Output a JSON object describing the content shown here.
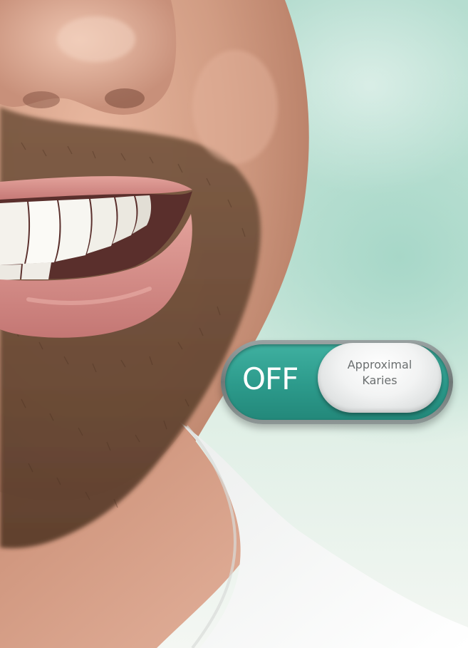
{
  "image": {
    "subject": "smiling-man-beard-closeup",
    "colors": {
      "skin": "#d9a38a",
      "beard": "#6a4a34",
      "lips": "#d28a86",
      "teeth": "#f7f6f2",
      "shirt": "#f7f7f5",
      "background": "#b6ddd0"
    }
  },
  "toggle": {
    "state_label": "OFF",
    "feature_label_line1": "Approximal",
    "feature_label_line2": "Karies",
    "colors": {
      "track": "#2c9a8b",
      "frame": "#6f7877",
      "knob": "#f2f3f3",
      "label": "#6b6f70"
    }
  }
}
